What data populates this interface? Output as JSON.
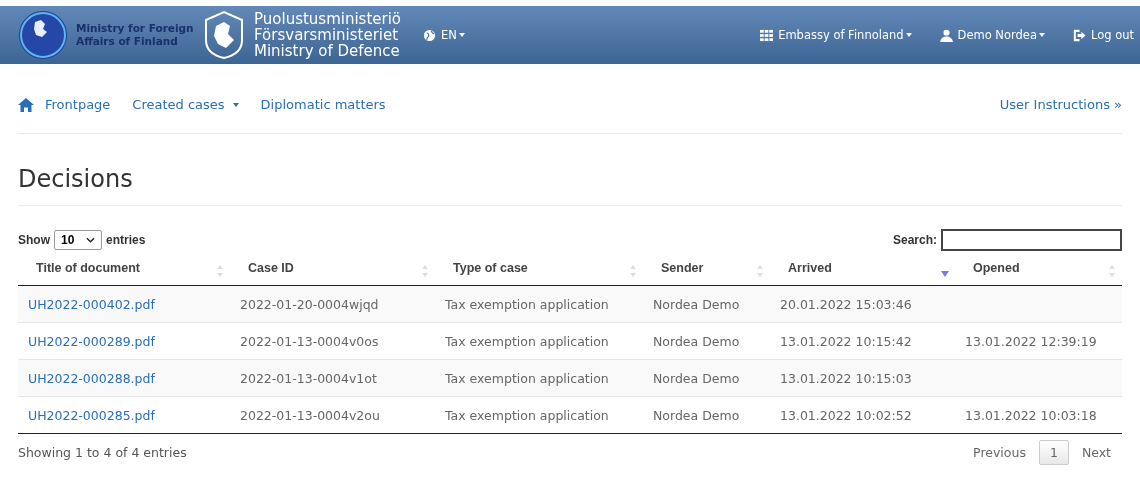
{
  "header": {
    "mfa_logo": "Ministry for Foreign Affairs of Finland",
    "defence_logo": [
      "Puolustusministeriö",
      "Försvarsministeriet",
      "Ministry of Defence"
    ],
    "language": "EN",
    "embassy": "Embassy of Finnoland",
    "user": "Demo Nordea",
    "logout": "Log out"
  },
  "nav": {
    "items": [
      {
        "label": "Frontpage",
        "kind": "home"
      },
      {
        "label": "Created cases",
        "kind": "dropdown"
      },
      {
        "label": "Diplomatic matters",
        "kind": "link"
      }
    ],
    "instructions": "User Instructions »"
  },
  "page_title": "Decisions",
  "table": {
    "show_label": "Show",
    "entries_value": "10",
    "entries_label": "entries",
    "search_label": "Search:",
    "columns": [
      {
        "label": "Title of document",
        "sorted": false
      },
      {
        "label": "Case ID",
        "sorted": false
      },
      {
        "label": "Type of case",
        "sorted": false
      },
      {
        "label": "Sender",
        "sorted": false
      },
      {
        "label": "Arrived",
        "sorted": true
      },
      {
        "label": "Opened",
        "sorted": false
      }
    ],
    "rows": [
      {
        "title": "UH2022-000402.pdf",
        "case_id": "2022-01-20-0004wjqd",
        "type": "Tax exemption application",
        "sender": "Nordea Demo",
        "arrived": "20.01.2022 15:03:46"
      },
      {
        "title": "UH2022-000289.pdf",
        "case_id": "2022-01-13-0004v0os",
        "type": "Tax exemption application",
        "sender": "Nordea Demo",
        "arrived": "13.01.2022 10:15:42",
        "opened": "13.01.2022 12:39:19"
      },
      {
        "title": "UH2022-000288.pdf",
        "case_id": "2022-01-13-0004v1ot",
        "type": "Tax exemption application",
        "sender": "Nordea Demo",
        "arrived": "13.01.2022 10:15:03"
      },
      {
        "title": "UH2022-000285.pdf",
        "case_id": "2022-01-13-0004v2ou",
        "type": "Tax exemption application",
        "sender": "Nordea Demo",
        "arrived": "13.01.2022 10:02:52",
        "opened": "13.01.2022 10:03:18"
      }
    ],
    "info": "Showing 1 to 4 of 4 entries",
    "pagination": [
      {
        "label": "Previous",
        "selected": false
      },
      {
        "label": "1",
        "selected": true
      },
      {
        "label": "Next",
        "selected": false
      }
    ]
  }
}
